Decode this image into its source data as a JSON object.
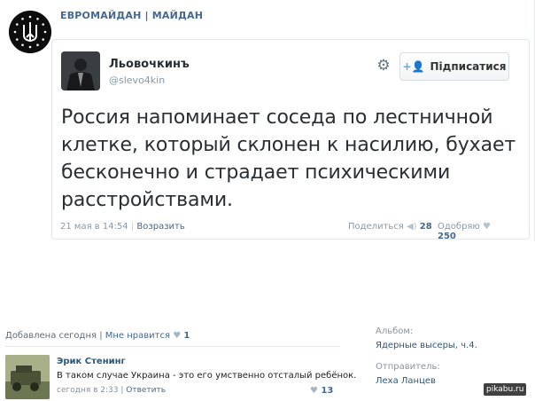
{
  "group": {
    "name": "ЕВРОМАЙДАН | МАЙДАН",
    "avatar_icon": "trident-emblem-icon"
  },
  "tweet": {
    "author_name": "Льовочкинъ",
    "author_handle": "@slevo4kin",
    "settings_icon": "gear-icon",
    "follow_label": "Підписатися",
    "follow_icon": "add-user-icon",
    "text": "Россия напоминает соседа по лестничной клетке, который склонен к насилию, бухает бесконечно и страдает психическими расстройствами.",
    "date": "21 мая в 14:54",
    "reply_label": "Возразить",
    "share_label": "Поделиться",
    "share_count": "28",
    "like_label": "Одобряю",
    "like_count": "250"
  },
  "post": {
    "added_label": "Добавлена сегодня",
    "like_link": "Мне нравится",
    "like_count": "1",
    "album_label": "Альбом:",
    "album_value": "Ядерные высеры, ч.4.",
    "sender_label": "Отправитель:",
    "sender_value": "Леха Ланцев"
  },
  "comment": {
    "author": "Эрик Стенинг",
    "text": "В таком случае Украина - это его умственно отсталый ребёнок.",
    "time": "сегодня в 2:33",
    "reply_label": "Ответить",
    "like_count": "13"
  },
  "watermark": "pikabu.ru",
  "colors": {
    "link": "#45688e",
    "dark_link": "#2b587a",
    "twitter_blue": "#55acee",
    "muted": "#8899a6"
  }
}
